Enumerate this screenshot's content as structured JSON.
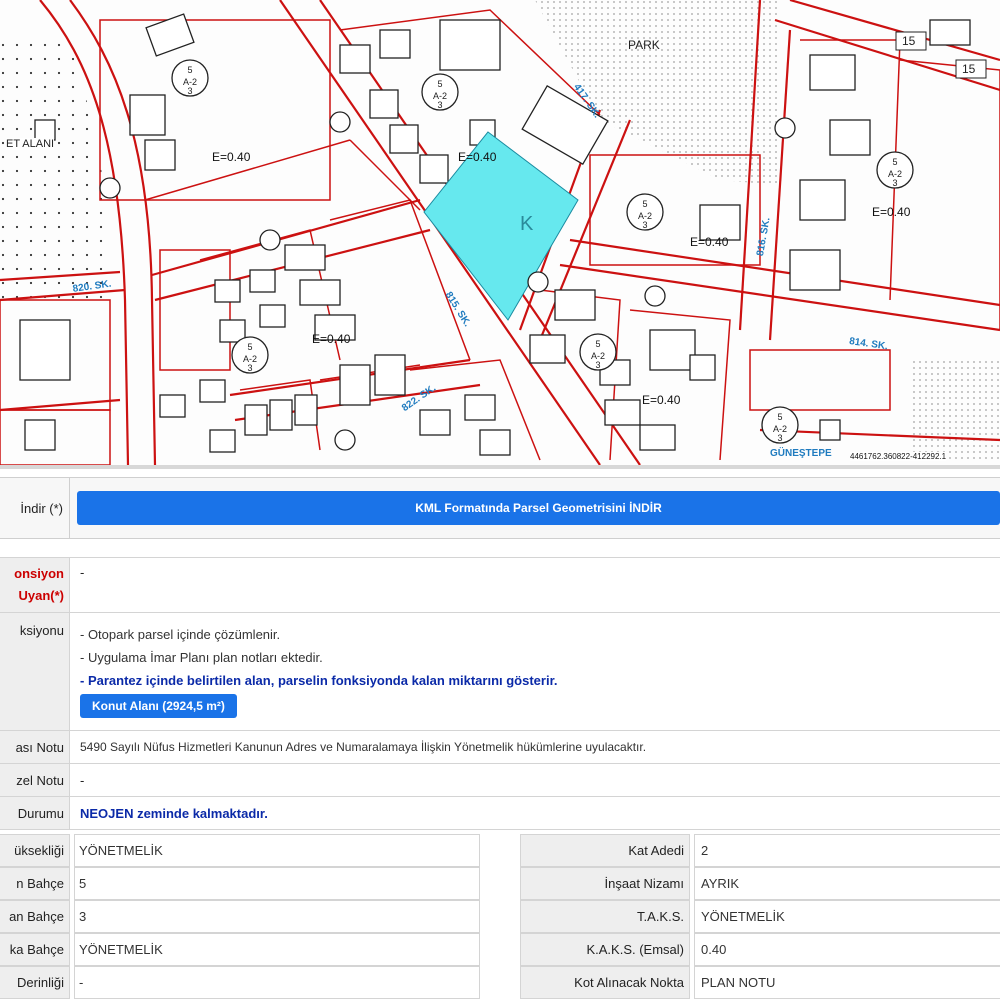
{
  "map": {
    "park_label": "PARK",
    "parcel_letter": "K",
    "area_label_left": "ET ALANI",
    "street_labels": [
      "417. SK.",
      "820. SK.",
      "815. SK.",
      "816. SK.",
      "814. SK.",
      "822. SK.",
      "GÜNEŞTEPE"
    ],
    "block_numbers": [
      "15",
      "15"
    ],
    "density_labels": [
      "E=0.40",
      "E=0.40",
      "E=0.40",
      "E=0.40",
      "E=0.40",
      "E=0.40"
    ],
    "coordinate_readout": "4461762.360822-412292.1",
    "colors": {
      "parcel_fill": "#66e8ee",
      "roads": "#cc1111",
      "streets": "#1f7bbf"
    }
  },
  "download": {
    "label": "İndir (*)",
    "button_label": "KML Formatında Parsel Geometrisini İNDİR"
  },
  "rows": {
    "konsiyon": {
      "label_line1": "onsiyon",
      "label_line2": "Uyan(*)",
      "value": "-"
    },
    "fonksiyon": {
      "label": "ksiyonu",
      "notes": [
        "- Otopark parsel içinde çözümlenir.",
        "- Uygulama İmar Planı plan notları ektedir.",
        "- Parantez içinde belirtilen alan, parselin fonksiyonda kalan miktarını gösterir."
      ],
      "area_button": "Konut Alanı (2924,5 m²)"
    },
    "adres": {
      "label": "ası Notu",
      "value": "5490 Sayılı Nüfus Hizmetleri Kanunun Adres ve Numaralamaya İlişkin Yönetmelik hükümlerine uyulacaktır."
    },
    "ozel": {
      "label": "zel Notu",
      "value": "-"
    },
    "durum": {
      "label": "Durumu",
      "value": "NEOJEN zeminde kalmaktadır."
    }
  },
  "grid": {
    "left": [
      {
        "label": "üksekliği",
        "value": "YÖNETMELİK"
      },
      {
        "label": "n Bahçe",
        "value": "5"
      },
      {
        "label": "an Bahçe",
        "value": "3"
      },
      {
        "label": "ka Bahçe",
        "value": "YÖNETMELİK"
      },
      {
        "label": "Derinliği",
        "value": "-"
      }
    ],
    "right": [
      {
        "label": "Kat Adedi",
        "value": "2"
      },
      {
        "label": "İnşaat Nizamı",
        "value": "AYRIK"
      },
      {
        "label": "T.A.K.S.",
        "value": "YÖNETMELİK"
      },
      {
        "label": "K.A.K.S. (Emsal)",
        "value": "0.40"
      },
      {
        "label": "Kot Alınacak Nokta",
        "value": "PLAN NOTU"
      }
    ]
  }
}
